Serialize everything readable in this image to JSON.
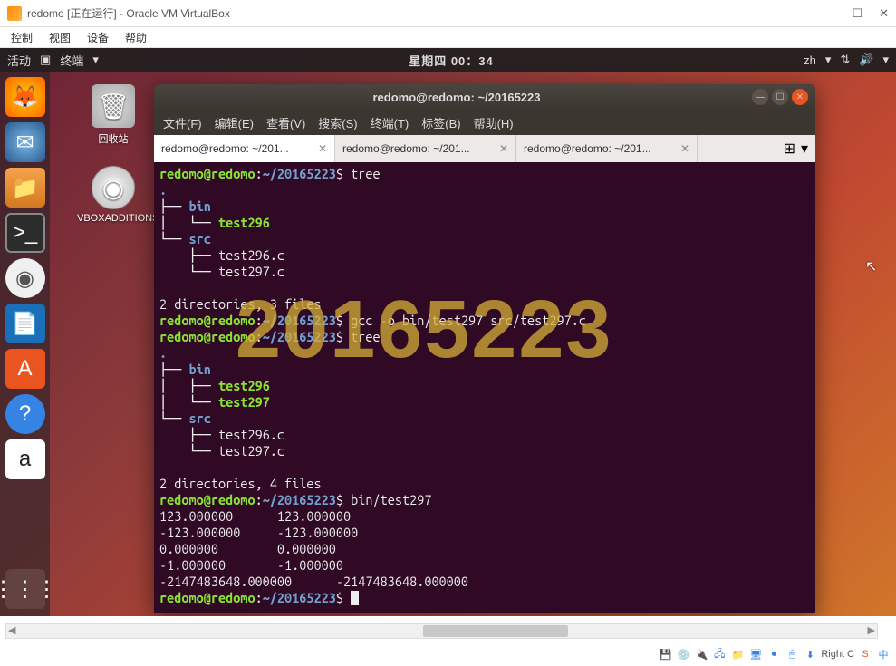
{
  "vbox": {
    "title": "redomo [正在运行] - Oracle VM VirtualBox",
    "menu": {
      "control": "控制",
      "view": "视图",
      "device": "设备",
      "help": "帮助"
    },
    "win": {
      "min": "—",
      "max": "☐",
      "close": "✕"
    },
    "status_right": "Right C"
  },
  "gnome": {
    "activities": "活动",
    "app": "终端",
    "clock": "星期四 00：34",
    "lang": "zh"
  },
  "desktop": {
    "trash": "回收站",
    "cdrom": "VBOXADDITIONS_4.3.12_93..."
  },
  "terminal": {
    "title": "redomo@redomo: ~/20165223",
    "menu": {
      "file": "文件(F)",
      "edit": "编辑(E)",
      "view": "查看(V)",
      "search": "搜索(S)",
      "term": "终端(T)",
      "tabs": "标签(B)",
      "help": "帮助(H)"
    },
    "tabs": [
      {
        "label": "redomo@redomo: ~/201..."
      },
      {
        "label": "redomo@redomo: ~/201..."
      },
      {
        "label": "redomo@redomo: ~/201..."
      }
    ],
    "prompt_user": "redomo@redomo",
    "prompt_path": "~/20165223",
    "cmd1": "tree",
    "tree1": {
      "bin": "bin",
      "test296": "test296",
      "src": "src",
      "test296c": "test296.c",
      "test297c": "test297.c",
      "summary": "2 directories, 3 files"
    },
    "cmd2": "gcc -o bin/test297 src/test297.c",
    "cmd3": "tree",
    "tree2": {
      "bin": "bin",
      "test296": "test296",
      "test297": "test297",
      "src": "src",
      "test296c": "test296.c",
      "test297c": "test297.c",
      "summary": "2 directories, 4 files"
    },
    "cmd4": "bin/test297",
    "output": {
      "l1": "123.000000      123.000000",
      "l2": "-123.000000     -123.000000",
      "l3": "0.000000        0.000000",
      "l4": "-1.000000       -1.000000",
      "l5": "-2147483648.000000      -2147483648.000000"
    }
  },
  "watermark": "20165223"
}
